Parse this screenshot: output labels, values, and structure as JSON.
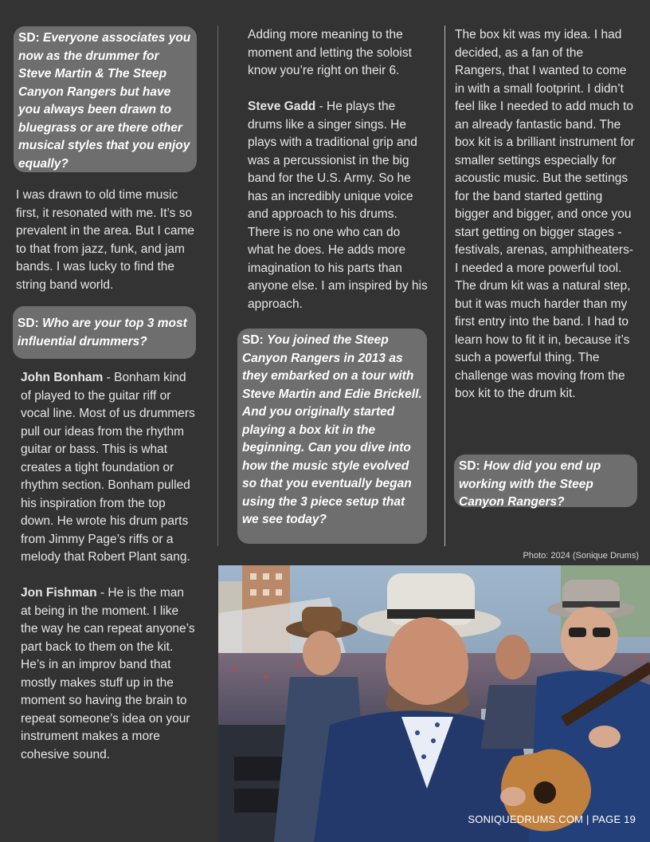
{
  "col1": {
    "q1": {
      "tag": "SD:",
      "text": "Everyone associates you now as the drummer for Steve Martin & The Steep Canyon Rangers but have you always been drawn to bluegrass or are there other musical styles that you enjoy equally?"
    },
    "a1": "I was drawn to old time music first, it resonated with me. It’s so prevalent in the area. But I came to that from jazz, funk, and jam bands. I was lucky to find the string band world.",
    "q2": {
      "tag": "SD:",
      "text": "Who are your top 3 most influential drummers?"
    },
    "drummer1": {
      "name": "John Bonham",
      "text": " - Bonham kind of played to the guitar riff or vocal line. Most of us drummers pull our ideas from the rhythm guitar or bass. This is what creates a tight foundation or rhythm section. Bonham pulled his inspiration from the top down. He wrote his drum parts from Jimmy Page’s riffs or a melody that Robert Plant sang."
    },
    "drummer2": {
      "name": "Jon Fishman",
      "text": " - He is the man at being in the moment. I like the way he can repeat anyone’s part back to them on the kit. He’s in an improv band that mostly makes stuff up in the moment so having the brain to repeat someone’s idea on your instrument makes a more cohesive sound."
    }
  },
  "col2": {
    "cont": "Adding more meaning to the moment and letting the soloist know you’re right on their 6.",
    "drummer3": {
      "name": "Steve Gadd",
      "text": " -  He plays the drums like a singer sings. He plays with a traditional grip and was a percussionist in the big band for the U.S. Army. So he has an incredibly unique voice and approach to his drums. There is no one who can do what he does. He adds more imagination to his parts than anyone else. I am inspired by his approach."
    },
    "q3": {
      "tag": "SD:",
      "text": "You joined the Steep Canyon Rangers in 2013 as they embarked on a tour with Steve Martin and Edie Brickell. And you originally started playing a box kit in the beginning. Can you dive into how the music style evolved so that you eventually began using the 3 piece setup that we see today?"
    }
  },
  "col3": {
    "a3": "The box kit was my idea. I had decided, as a fan of the Rangers, that I wanted to come in with a small footprint. I didn’t feel like I needed to add much to an already fantastic band. The box kit is a brilliant instrument for smaller settings especially for acoustic music. But the settings for the band started getting bigger and bigger, and once you start getting on bigger stages - festivals, arenas, amphitheaters- I needed a more powerful tool. The drum kit was a natural step, but it was much harder than my first entry into the band. I had to learn how to fit it in, because it’s such a powerful thing. The challenge was moving from the box kit to the drum kit.",
    "q4": {
      "tag": "SD:",
      "text": "How did you end up working with the Steep Canyon Rangers?"
    }
  },
  "photo": {
    "caption": "Photo: 2024 (Sonique Drums)"
  },
  "footer": {
    "text": "SONIQUEDRUMS.COM | PAGE 19"
  }
}
